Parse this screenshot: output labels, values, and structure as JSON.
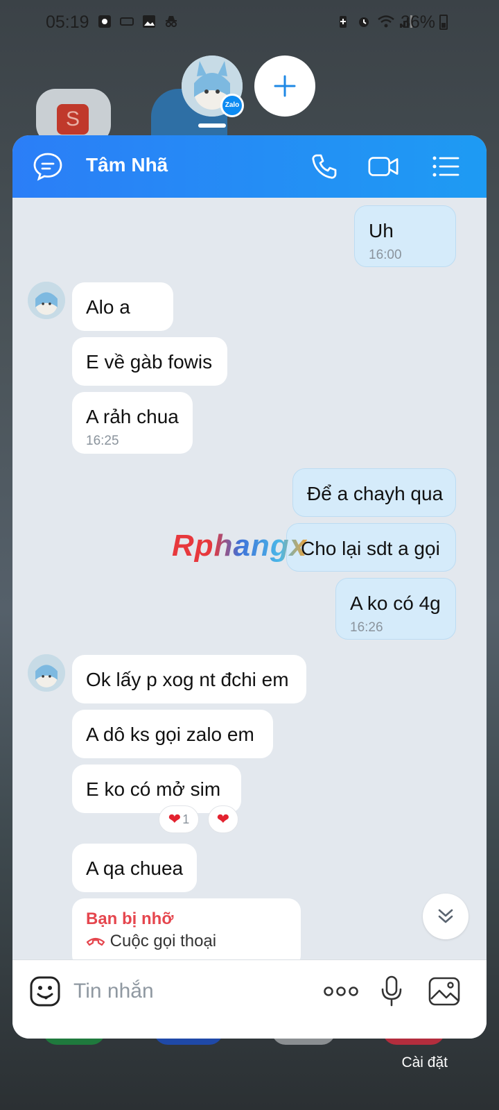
{
  "status_bar": {
    "time": "05:19",
    "battery": "36%"
  },
  "bubble_heads": {
    "badge": "Zalo"
  },
  "chat": {
    "contact_name": "Tâm Nhã",
    "messages": [
      {
        "side": "out",
        "text": "Uh",
        "time": "16:00"
      },
      {
        "side": "in",
        "text": "Alo a"
      },
      {
        "side": "in",
        "text": "E về gàb fowis"
      },
      {
        "side": "in",
        "text": "A rảh chua",
        "time": "16:25"
      },
      {
        "side": "out",
        "text": "Để a chayh qua"
      },
      {
        "side": "out",
        "text": "Cho lại sdt a gọi"
      },
      {
        "side": "out",
        "text": "A ko có 4g",
        "time": "16:26"
      },
      {
        "side": "in",
        "text": "Ok lấy p xog nt đchi em"
      },
      {
        "side": "in",
        "text": "A dô ks gọi zalo em"
      },
      {
        "side": "in",
        "text": "E ko có mở sim",
        "reaction_count": "1"
      },
      {
        "side": "in",
        "text": "A qa chuea"
      }
    ],
    "missed_call": {
      "title": "Bạn bị nhỡ",
      "subtitle": "Cuộc gọi thoại"
    },
    "input_placeholder": "Tin nhắn"
  },
  "settings_label": "Cài đặt",
  "watermark": "Rphangx",
  "colors": {
    "header_start": "#2b7ef7",
    "header_end": "#1e9bf3",
    "outgoing_bubble": "#d5ebfa",
    "missed": "#e5464e",
    "heart": "#e3222f"
  }
}
